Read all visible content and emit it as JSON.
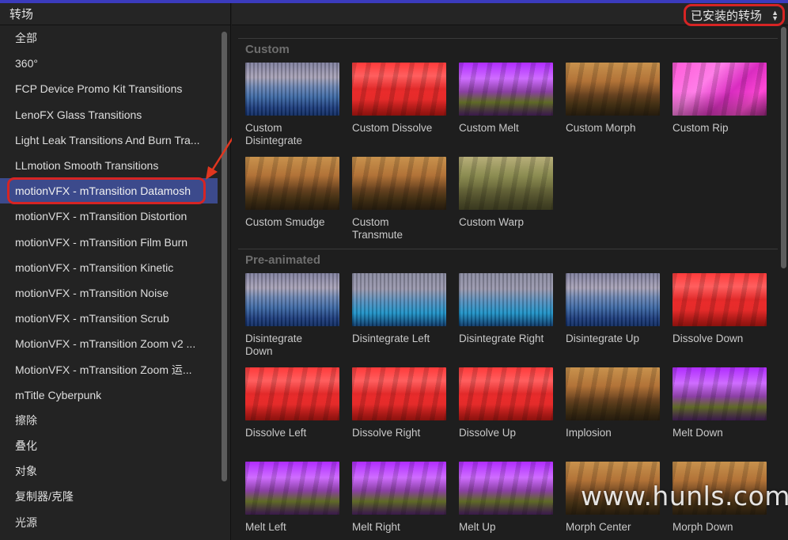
{
  "left_panel": {
    "title": "转场",
    "items": [
      {
        "label": "全部"
      },
      {
        "label": "360°"
      },
      {
        "label": "FCP Device Promo Kit Transitions"
      },
      {
        "label": "LenoFX Glass Transitions"
      },
      {
        "label": "Light Leak Transitions And Burn Tra..."
      },
      {
        "label": "LLmotion Smooth Transitions"
      },
      {
        "label": "motionVFX - mTransition Datamosh",
        "selected": true
      },
      {
        "label": "motionVFX - mTransition Distortion"
      },
      {
        "label": "motionVFX - mTransition Film Burn"
      },
      {
        "label": "motionVFX - mTransition Kinetic"
      },
      {
        "label": "motionVFX - mTransition Noise"
      },
      {
        "label": "motionVFX - mTransition Scrub"
      },
      {
        "label": "MotionVFX - mTransition Zoom v2 ..."
      },
      {
        "label": "MotionVFX - mTransition Zoom 运..."
      },
      {
        "label": "mTitle Cyberpunk"
      },
      {
        "label": "擦除"
      },
      {
        "label": "叠化"
      },
      {
        "label": "对象"
      },
      {
        "label": "复制器/克隆"
      },
      {
        "label": "光源"
      }
    ]
  },
  "right_panel": {
    "filter_label": "已安装的转场",
    "sections": [
      {
        "title": "Custom",
        "items": [
          {
            "label": "Custom\nDisintegrate",
            "palette": "blue"
          },
          {
            "label": "Custom Dissolve",
            "palette": "red"
          },
          {
            "label": "Custom Melt",
            "palette": "purple"
          },
          {
            "label": "Custom Morph",
            "palette": "forest"
          },
          {
            "label": "Custom Rip",
            "palette": "pink"
          },
          {
            "label": "Custom Smudge",
            "palette": "forest"
          },
          {
            "label": "Custom\nTransmute",
            "palette": "forest"
          },
          {
            "label": "Custom Warp",
            "palette": "olive"
          }
        ]
      },
      {
        "title": "Pre-animated",
        "items": [
          {
            "label": "Disintegrate\nDown",
            "palette": "blue"
          },
          {
            "label": "Disintegrate Left",
            "palette": "teal"
          },
          {
            "label": "Disintegrate Right",
            "palette": "teal"
          },
          {
            "label": "Disintegrate Up",
            "palette": "blue"
          },
          {
            "label": "Dissolve Down",
            "palette": "red"
          },
          {
            "label": "Dissolve Left",
            "palette": "red"
          },
          {
            "label": "Dissolve Right",
            "palette": "red"
          },
          {
            "label": "Dissolve Up",
            "palette": "red"
          },
          {
            "label": "Implosion",
            "palette": "forest"
          },
          {
            "label": "Melt Down",
            "palette": "purple"
          },
          {
            "label": "Melt Left",
            "palette": "purple"
          },
          {
            "label": "Melt Right",
            "palette": "purple"
          },
          {
            "label": "Melt Up",
            "palette": "purple"
          },
          {
            "label": "Morph Center",
            "palette": "forest"
          },
          {
            "label": "Morph Down",
            "palette": "forest"
          }
        ]
      }
    ]
  },
  "watermark": "www.hunls.com",
  "colors": {
    "selection": "#3c4a8c",
    "annotation_red": "#d62424",
    "accent_bar": "#3b3bbd"
  }
}
